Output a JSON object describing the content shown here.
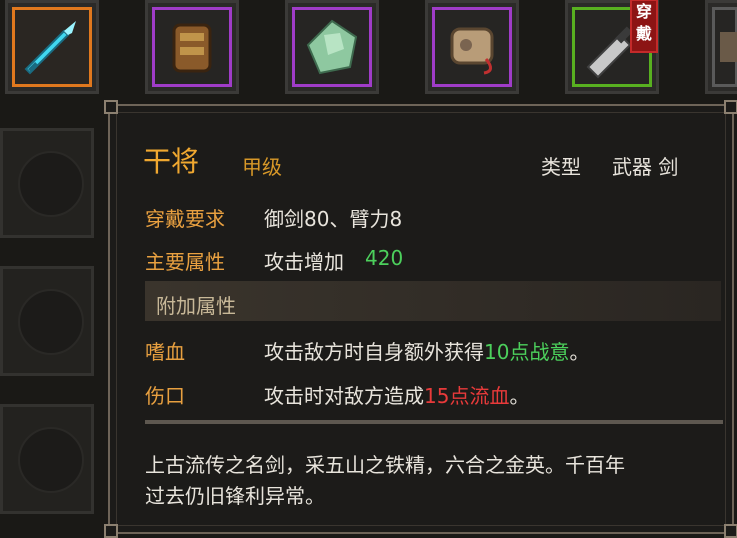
{
  "slots": [
    {
      "icon": "sword-icon",
      "frame": "orange"
    },
    {
      "icon": "armor-icon",
      "frame": "purple"
    },
    {
      "icon": "jade-icon",
      "frame": "purple"
    },
    {
      "icon": "scroll-pouch-icon",
      "frame": "purple"
    },
    {
      "icon": "blade-icon",
      "frame": "green",
      "badge": "穿戴"
    },
    {
      "icon": "item-icon",
      "frame": "gray"
    }
  ],
  "item": {
    "name": "干将",
    "grade": "甲级",
    "type_label": "类型",
    "type_value": "武器 剑",
    "req_label": "穿戴要求",
    "req_value": "御剑80、臂力8",
    "main_label": "主要属性",
    "main_text": "攻击增加",
    "main_value": "420",
    "extra_header": "附加属性",
    "extras": [
      {
        "name": "嗜血",
        "pre": "攻击敌方时自身额外获得",
        "highlight": "10点战意",
        "post": "。",
        "color": "#4cd05c"
      },
      {
        "name": "伤口",
        "pre": "攻击时对敌方造成",
        "highlight": "15点流血",
        "post": "。",
        "color": "#e83a3a"
      }
    ],
    "description_line1": "上古流传之名剑，采五山之铁精，六合之金英。千百年",
    "description_line2": "过去仍旧锋利异常。"
  }
}
